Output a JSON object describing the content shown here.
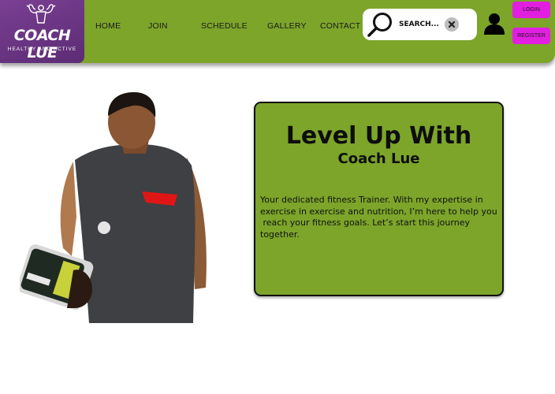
{
  "brand": {
    "name": "COACH LUE",
    "tagline": "HEALTHY AND ACTIVE",
    "logo_icon": "flexing-arms-icon",
    "color_primary": "#7ca52a",
    "color_logo": "#6a3584",
    "color_auth_button": "#e21fe0"
  },
  "nav": {
    "home": "HOME",
    "join": "JOIN",
    "schedule": "SCHEDULE",
    "gallery": "GALLERY",
    "contact": "CONTACT"
  },
  "search": {
    "placeholder": "SEARCH...",
    "icon": "search-icon",
    "clear_icon": "close-icon"
  },
  "account": {
    "icon": "user-icon",
    "login_label": "LOGIN",
    "register_label": "REGISTER"
  },
  "hero": {
    "photo": "coach-photo",
    "heading": "Level Up With",
    "subheading": "Coach Lue",
    "body_lines": [
      "Your dedicated fitness Trainer. With my expertise in",
      "exercise in exercise and nutrition, I’m here to help you",
      " reach your fitness goals. Let’s start this journey",
      "together."
    ]
  }
}
